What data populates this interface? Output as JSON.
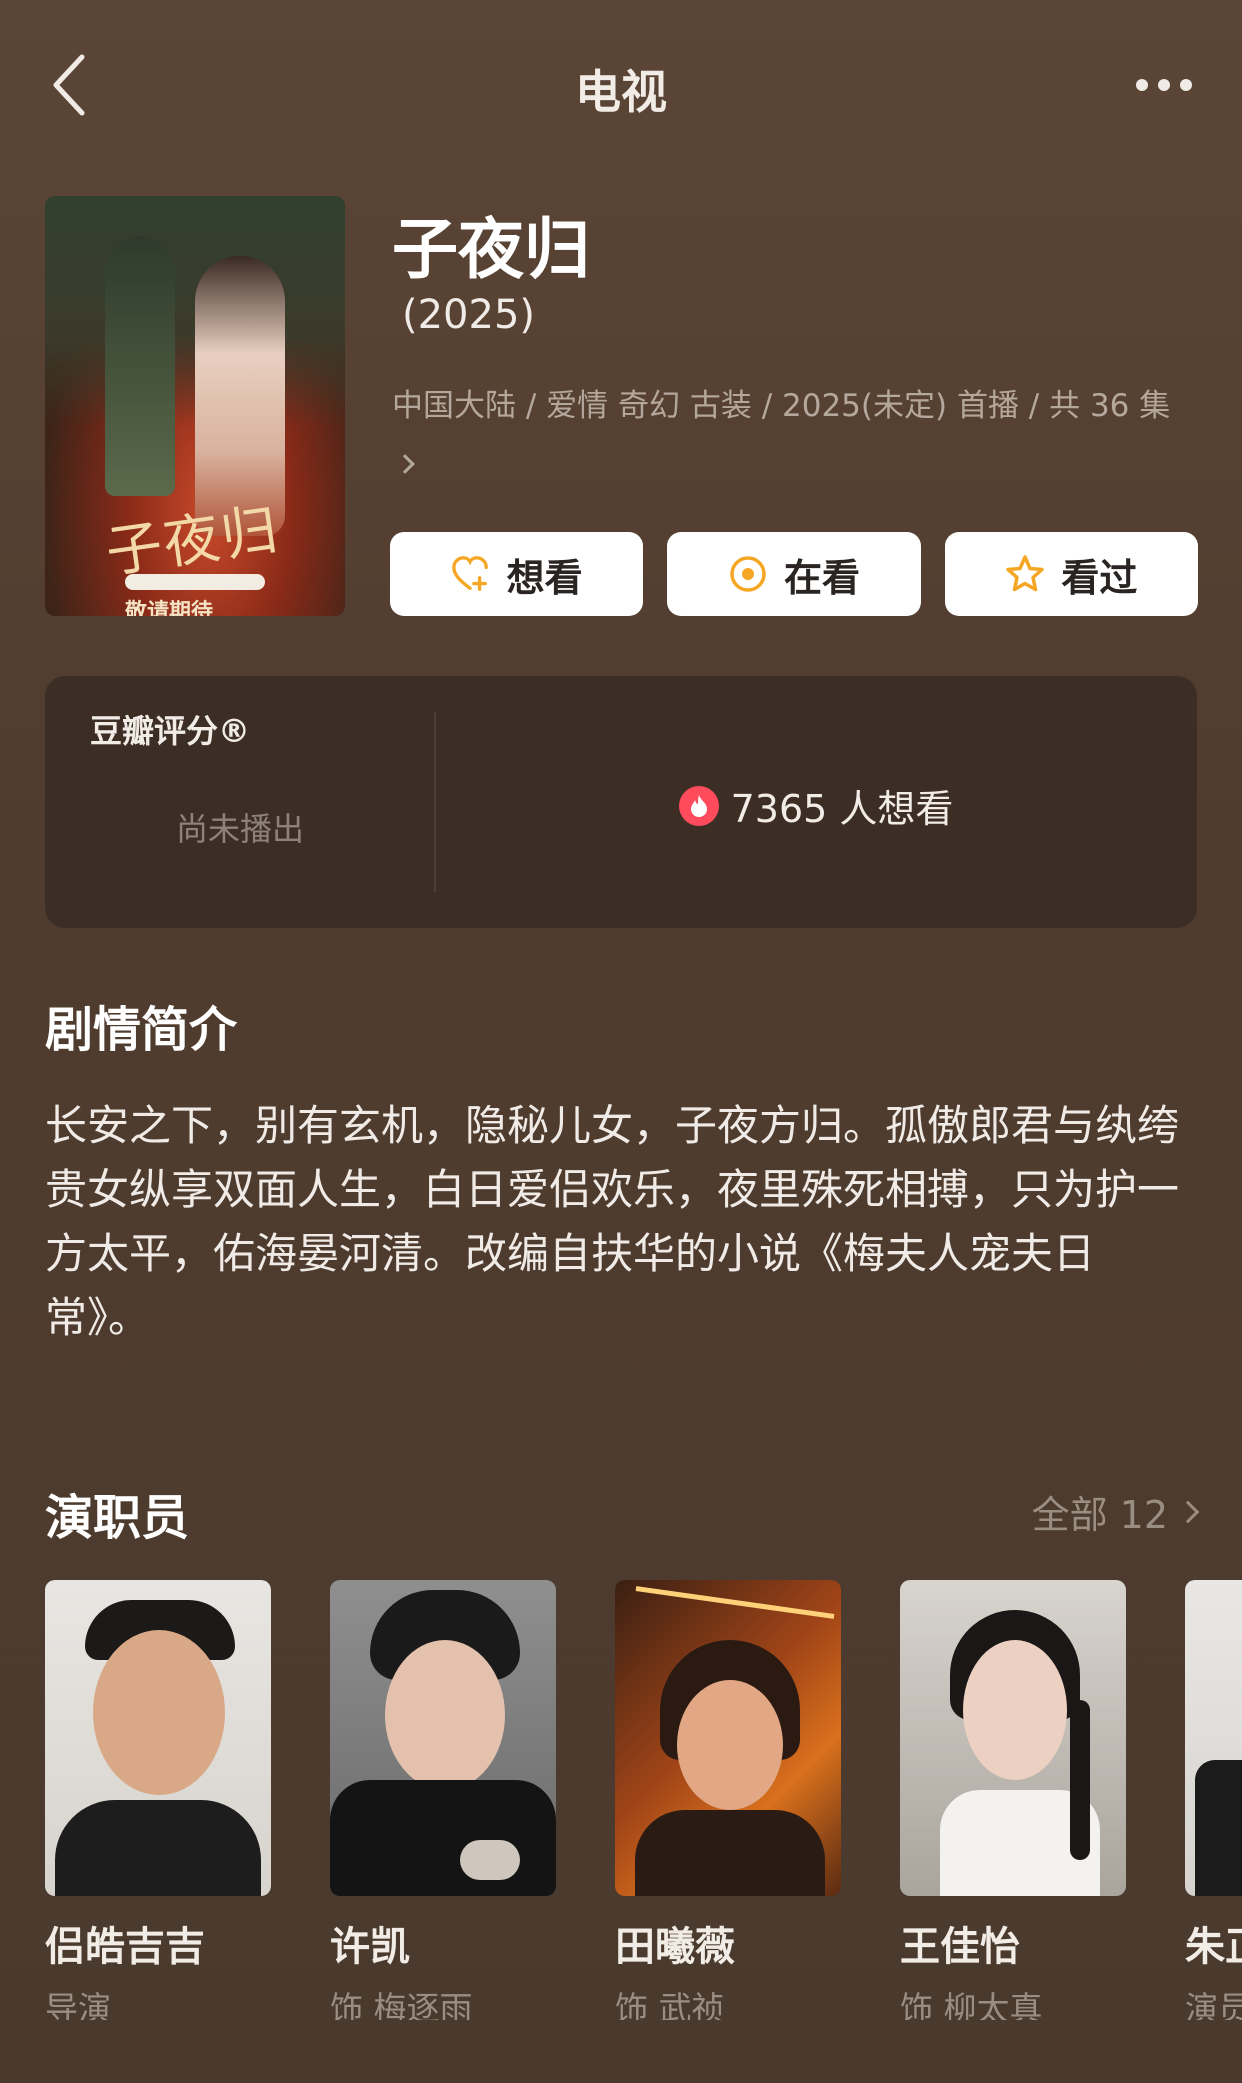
{
  "nav": {
    "title": "电视",
    "back_icon": "chevron-left-icon",
    "more_icon": "more-dots-icon"
  },
  "poster": {
    "title_text": "子夜归",
    "tagline": "敬请期待"
  },
  "show": {
    "title": "子夜归",
    "year": "(2025)",
    "meta": "中国大陆 / 爱情 奇幻 古装 / 2025(未定) 首播 / 共 36 集"
  },
  "actions": [
    {
      "label": "想看",
      "icon": "heart-plus-icon"
    },
    {
      "label": "在看",
      "icon": "target-icon"
    },
    {
      "label": "看过",
      "icon": "star-icon"
    }
  ],
  "rating": {
    "label": "豆瓣评分®",
    "status": "尚未播出",
    "want_count": "7365 人想看",
    "accent": "#ff4b5c"
  },
  "synopsis": {
    "heading": "剧情简介",
    "text": "长安之下，别有玄机，隐秘儿女，子夜方归。孤傲郎君与纨绔贵女纵享双面人生，白日爱侣欢乐，夜里殊死相搏，只为护一方太平，佑海晏河清。改编自扶华的小说《梅夫人宠夫日常》。"
  },
  "cast": {
    "heading": "演职员",
    "see_all": "全部 12",
    "members": [
      {
        "name": "侣皓吉吉",
        "role": "导演"
      },
      {
        "name": "许凯",
        "role": "饰 梅逐雨"
      },
      {
        "name": "田曦薇",
        "role": "饰 武祯"
      },
      {
        "name": "王佳怡",
        "role": "饰 柳太真"
      },
      {
        "name": "朱正",
        "role": "演员"
      }
    ]
  }
}
